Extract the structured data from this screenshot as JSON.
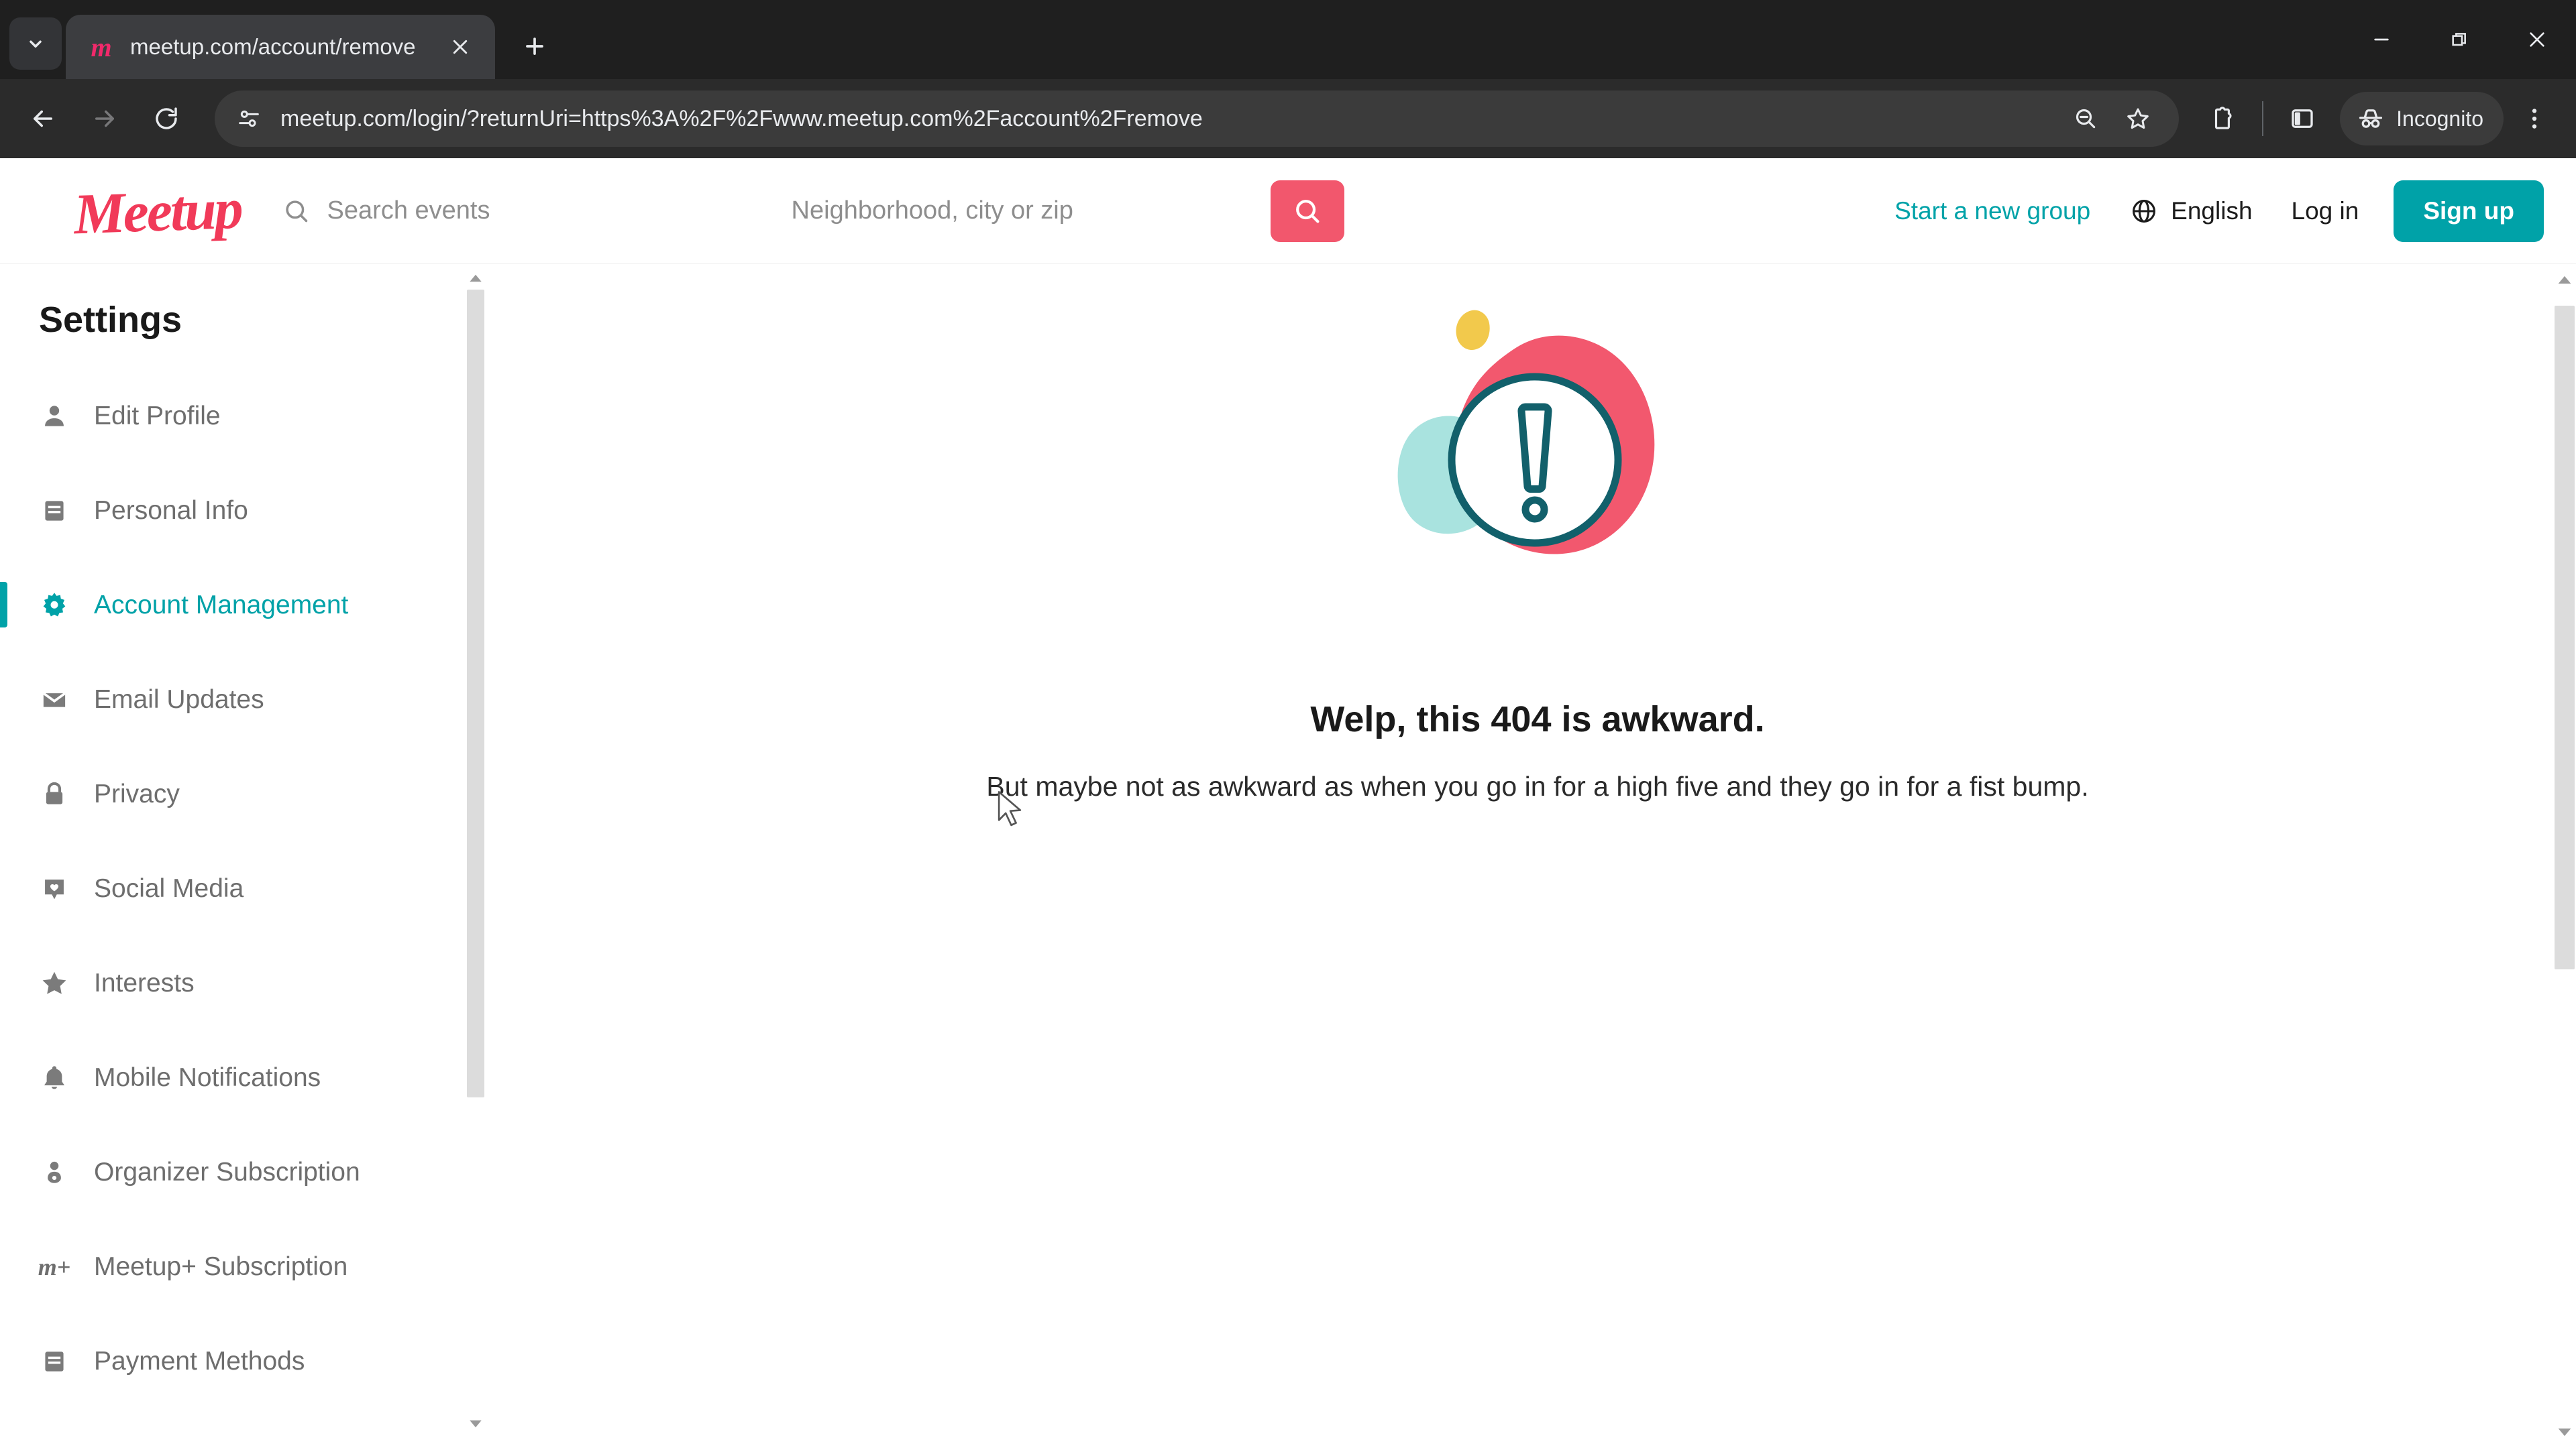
{
  "browser": {
    "tab": {
      "title": "meetup.com/account/remove",
      "favicon_icon": "meetup-m-icon",
      "favicon_glyph": "m",
      "close_icon": "close-icon"
    },
    "tab_search_icon": "chevron-down-icon",
    "new_tab_icon": "plus-icon",
    "window_controls": {
      "minimize_icon": "minimize-icon",
      "restore_icon": "restore-icon",
      "close_icon": "close-icon"
    },
    "toolbar": {
      "back_icon": "arrow-left-icon",
      "forward_icon": "arrow-right-icon",
      "reload_icon": "reload-icon",
      "site_info_icon": "tune-settings-icon",
      "url": "meetup.com/login/?returnUri=https%3A%2F%2Fwww.meetup.com%2Faccount%2Fremove",
      "zoom_icon": "zoom-out-icon",
      "bookmark_icon": "star-icon",
      "extensions_icon": "extensions-puzzle-icon",
      "side_panel_icon": "side-panel-icon",
      "incognito_icon": "incognito-hat-icon",
      "incognito_label": "Incognito",
      "menu_icon": "three-dot-menu-icon"
    }
  },
  "site_header": {
    "logo_text": "Meetup",
    "search_events": {
      "value": "",
      "placeholder": "Search events",
      "icon": "search-icon"
    },
    "search_location": {
      "value": "",
      "placeholder": "Neighborhood, city or zip"
    },
    "search_submit_icon": "search-icon",
    "start_group_label": "Start a new group",
    "language_icon": "globe-icon",
    "language_label": "English",
    "login_label": "Log in",
    "signup_label": "Sign up"
  },
  "sidebar": {
    "title": "Settings",
    "items": [
      {
        "label": "Edit Profile",
        "icon": "person-icon",
        "active": false
      },
      {
        "label": "Personal Info",
        "icon": "card-info-icon",
        "active": false
      },
      {
        "label": "Account Management",
        "icon": "gear-icon",
        "active": true
      },
      {
        "label": "Email Updates",
        "icon": "envelope-icon",
        "active": false
      },
      {
        "label": "Privacy",
        "icon": "lock-icon",
        "active": false
      },
      {
        "label": "Social Media",
        "icon": "heart-badge-icon",
        "active": false
      },
      {
        "label": "Interests",
        "icon": "star-icon",
        "active": false
      },
      {
        "label": "Mobile Notifications",
        "icon": "bell-icon",
        "active": false
      },
      {
        "label": "Organizer Subscription",
        "icon": "person-gear-icon",
        "active": false
      },
      {
        "label": "Meetup+ Subscription",
        "icon": "meetup-plus-icon",
        "active": false
      },
      {
        "label": "Payment Methods",
        "icon": "card-info-icon",
        "active": false
      }
    ],
    "scroll_up_icon": "scroll-up-arrow-icon",
    "scroll_down_icon": "scroll-down-arrow-icon"
  },
  "main": {
    "illustration_icon": "error-exclamation-illustration",
    "error_title": "Welp, this 404 is awkward.",
    "error_subtitle": "But maybe not as awkward as when you go in for a high five and they go in for a fist bump."
  },
  "page_scroll": {
    "up_icon": "scroll-up-arrow-icon",
    "down_icon": "scroll-down-arrow-icon"
  },
  "colors": {
    "meetup_red": "#f13a59",
    "teal_accent": "#00a2a8",
    "coral": "#f2576d",
    "yellow": "#f2c94c",
    "light_teal": "#a8e4e0",
    "dark_teal_stroke": "#12606b",
    "chrome_dark": "#2b2b2b",
    "tab_active": "#3c3d40"
  }
}
